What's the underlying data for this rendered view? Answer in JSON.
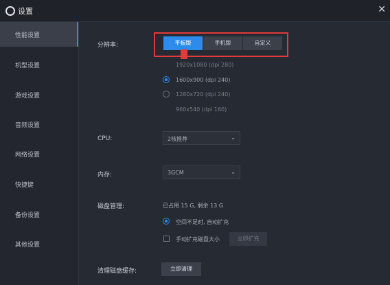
{
  "window": {
    "title": "设置",
    "close_glyph": "✕"
  },
  "sidebar": {
    "items": [
      {
        "label": "性能设置",
        "active": true
      },
      {
        "label": "机型设置"
      },
      {
        "label": "游戏设置"
      },
      {
        "label": "音频设置"
      },
      {
        "label": "网络设置"
      },
      {
        "label": "快捷键"
      },
      {
        "label": "备份设置"
      },
      {
        "label": "其他设置"
      }
    ]
  },
  "resolution": {
    "label": "分辨率:",
    "modes": [
      "平板版",
      "手机版",
      "自定义"
    ],
    "selected_mode": "平板版",
    "options": [
      {
        "label": "1920x1080 (dpi 280)",
        "selected": false
      },
      {
        "label": "1600x900 (dpi 240)",
        "selected": true
      },
      {
        "label": "1280x720 (dpi 240)",
        "selected": false
      },
      {
        "label": "960x540 (dpi 160)",
        "selected": false
      }
    ]
  },
  "cpu": {
    "label": "CPU:",
    "value": "2核推荐",
    "caret": "⌄"
  },
  "memory": {
    "label": "内存:",
    "value": "3GCM",
    "caret": "⌄"
  },
  "disk": {
    "label": "磁盘管理:",
    "info": "已占用 15 G, 剩余 13 G",
    "option_auto": "空间不足时, 自动扩充",
    "option_manual": "手动扩充磁盘大小",
    "expand_button": "立即扩充"
  },
  "cache": {
    "label": "清理磁盘缓存:",
    "button": "立即清理"
  },
  "colors": {
    "accent": "#2d8ceb",
    "highlight": "#e03a3a",
    "background": "#262a33"
  }
}
